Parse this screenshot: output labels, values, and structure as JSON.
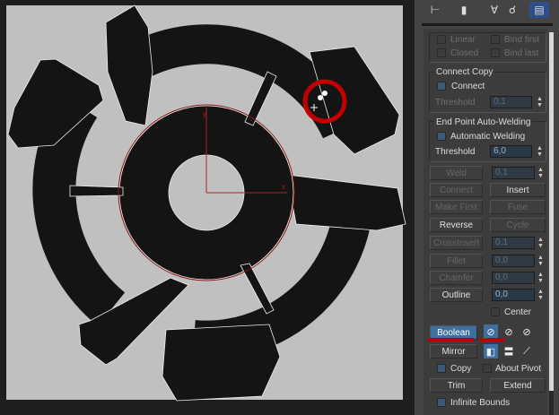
{
  "viewport": {
    "axis_x": "x",
    "axis_y": "y",
    "annotation_color": "#c00000",
    "background": "#c0c0c0",
    "shape_color": "#141414"
  },
  "toolbar": {
    "icons": [
      "pin-icon",
      "hierarchy-icon",
      "motion-icon",
      "display-icon",
      "utilities-icon"
    ]
  },
  "group_top": {
    "linear": "Linear",
    "closed": "Closed",
    "bind_first": "Bind first",
    "bind_last": "Bind last"
  },
  "connect_copy": {
    "title": "Connect Copy",
    "connect": "Connect",
    "threshold_label": "Threshold",
    "threshold": "0,1"
  },
  "auto_weld": {
    "title": "End Point Auto-Welding",
    "automatic": "Automatic Welding",
    "threshold_label": "Threshold",
    "threshold": "6,0"
  },
  "ops": {
    "weld": "Weld",
    "weld_value": "0,1",
    "connect": "Connect",
    "insert": "Insert",
    "make_first": "Make First",
    "fuse": "Fuse",
    "reverse": "Reverse",
    "cycle": "Cycle",
    "crossinsert": "CrossInsert",
    "crossinsert_value": "0,1",
    "fillet": "Fillet",
    "fillet_value": "0,0",
    "chamfer": "Chamfer",
    "chamfer_value": "0,0",
    "outline": "Outline",
    "outline_value": "0,0",
    "center": "Center",
    "boolean": "Boolean",
    "mirror": "Mirror",
    "copy": "Copy",
    "about_pivot": "About Pivot",
    "trim": "Trim",
    "extend": "Extend",
    "infinite_bounds": "Infinite Bounds"
  }
}
